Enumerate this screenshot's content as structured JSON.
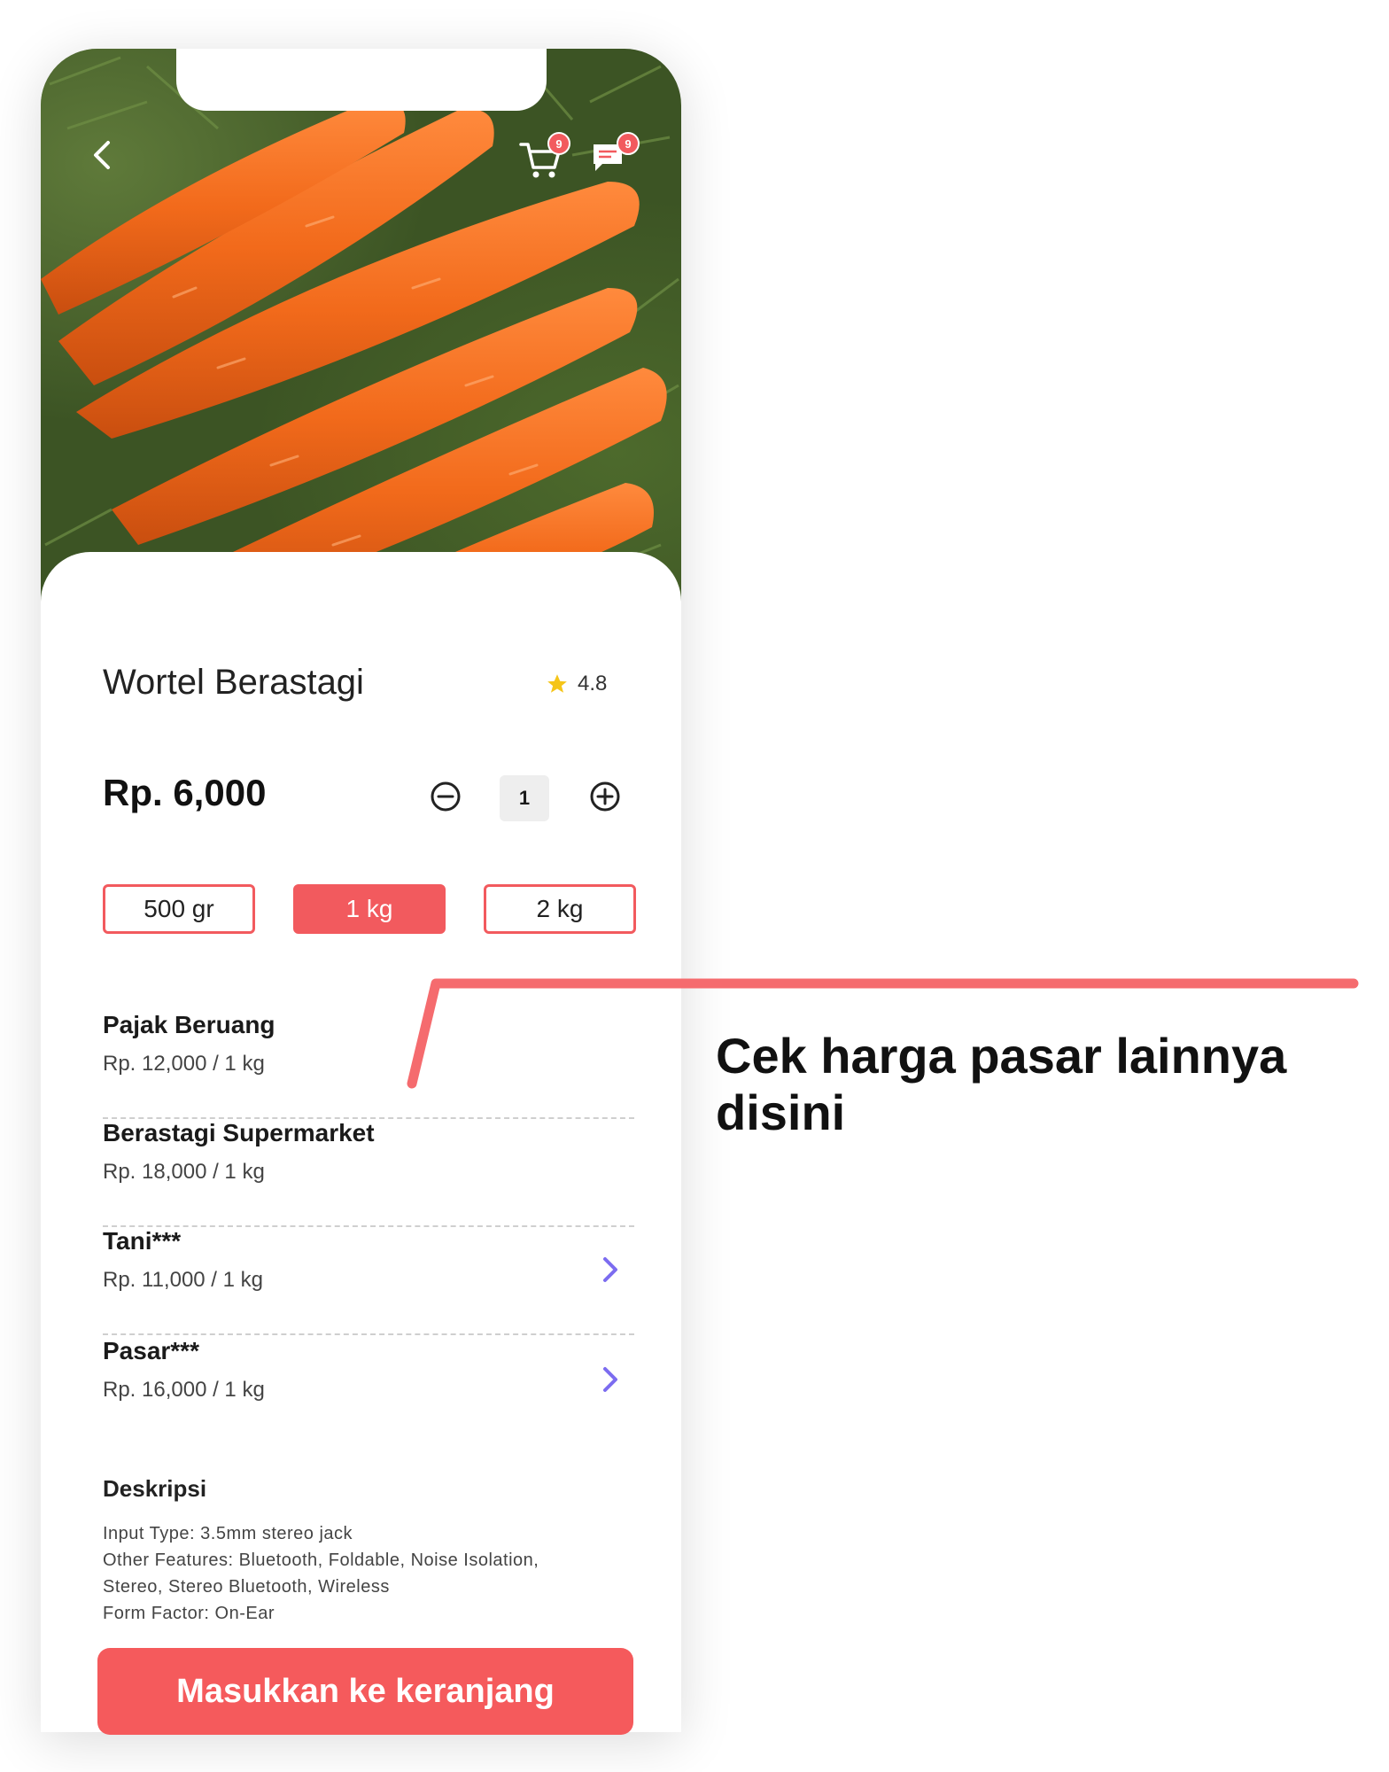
{
  "header": {
    "back_icon": "chevron-left-icon",
    "cart_badge": "9",
    "chat_badge": "9"
  },
  "product": {
    "name": "Wortel Berastagi",
    "rating": "4.8",
    "price": "Rp. 6,000",
    "quantity": "1"
  },
  "weight_options": [
    {
      "label": "500 gr",
      "selected": false
    },
    {
      "label": "1 kg",
      "selected": true
    },
    {
      "label": "2 kg",
      "selected": false
    }
  ],
  "markets": [
    {
      "name": "Pajak Beruang",
      "price": "Rp. 12,000 / 1 kg"
    },
    {
      "name": "Berastagi Supermarket",
      "price": "Rp. 18,000 / 1 kg"
    },
    {
      "name": "Tani***",
      "price": "Rp. 11,000 / 1 kg"
    },
    {
      "name": "Pasar***",
      "price": "Rp. 16,000 / 1 kg"
    }
  ],
  "description": {
    "title": "Deskripsi",
    "lines": [
      "Input Type: 3.5mm stereo jack",
      "Other Features: Bluetooth, Foldable, Noise Isolation,",
      "Stereo, Stereo Bluetooth, Wireless",
      "Form Factor: On-Ear"
    ]
  },
  "cta_label": "Masukkan ke keranjang",
  "callout": {
    "line1": "Cek harga pasar lainnya",
    "line2": "disini"
  },
  "colors": {
    "accent": "#f25a5e",
    "chevron": "#7c6cf0",
    "star": "#f5c518"
  }
}
